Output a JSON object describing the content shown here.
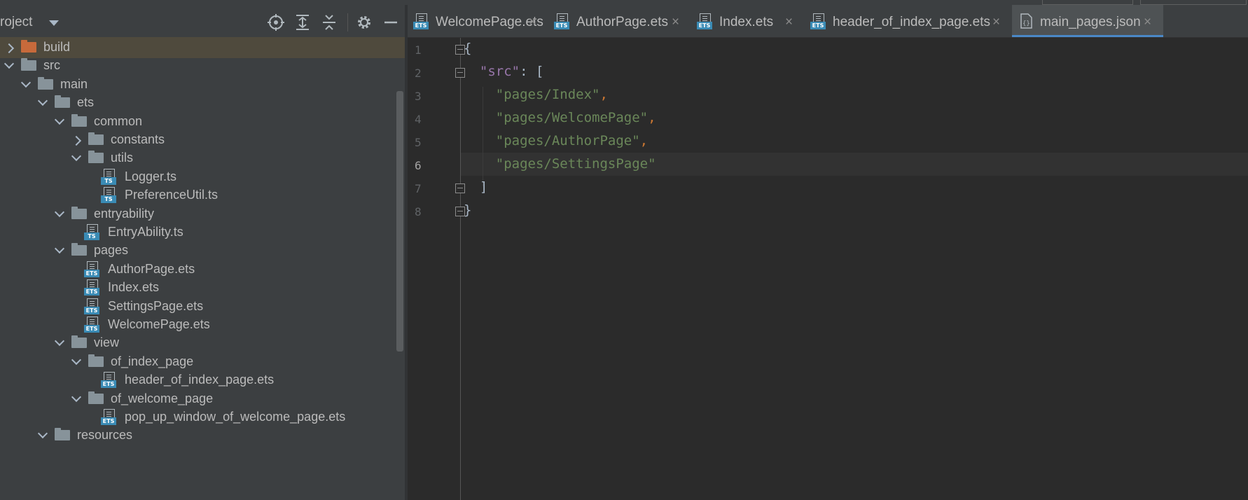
{
  "project_panel": {
    "title": "roject",
    "toolbar": [
      "target-icon",
      "expand-all-icon",
      "collapse-all-icon",
      "gear-icon",
      "minimize-icon"
    ],
    "tree": [
      {
        "label": "build",
        "type": "folder",
        "depth": 0,
        "expanded": false,
        "color": "#c76a3b",
        "selected": true
      },
      {
        "label": "src",
        "type": "folder",
        "depth": 0,
        "expanded": true
      },
      {
        "label": "main",
        "type": "folder",
        "depth": 1,
        "expanded": true
      },
      {
        "label": "ets",
        "type": "folder",
        "depth": 2,
        "expanded": true
      },
      {
        "label": "common",
        "type": "folder",
        "depth": 3,
        "expanded": true
      },
      {
        "label": "constants",
        "type": "folder",
        "depth": 4,
        "expanded": false
      },
      {
        "label": "utils",
        "type": "folder",
        "depth": 4,
        "expanded": true
      },
      {
        "label": "Logger.ts",
        "type": "file",
        "badge": "TS",
        "depth": 5
      },
      {
        "label": "PreferenceUtil.ts",
        "type": "file",
        "badge": "TS",
        "depth": 5
      },
      {
        "label": "entryability",
        "type": "folder",
        "depth": 3,
        "expanded": true
      },
      {
        "label": "EntryAbility.ts",
        "type": "file",
        "badge": "TS",
        "depth": 4
      },
      {
        "label": "pages",
        "type": "folder",
        "depth": 3,
        "expanded": true
      },
      {
        "label": "AuthorPage.ets",
        "type": "file",
        "badge": "ETS",
        "depth": 4
      },
      {
        "label": "Index.ets",
        "type": "file",
        "badge": "ETS",
        "depth": 4
      },
      {
        "label": "SettingsPage.ets",
        "type": "file",
        "badge": "ETS",
        "depth": 4
      },
      {
        "label": "WelcomePage.ets",
        "type": "file",
        "badge": "ETS",
        "depth": 4
      },
      {
        "label": "view",
        "type": "folder",
        "depth": 3,
        "expanded": true
      },
      {
        "label": "of_index_page",
        "type": "folder",
        "depth": 4,
        "expanded": true
      },
      {
        "label": "header_of_index_page.ets",
        "type": "file",
        "badge": "ETS",
        "depth": 5
      },
      {
        "label": "of_welcome_page",
        "type": "folder",
        "depth": 4,
        "expanded": true
      },
      {
        "label": "pop_up_window_of_welcome_page.ets",
        "type": "file",
        "badge": "ETS",
        "depth": 5
      },
      {
        "label": "resources",
        "type": "folder",
        "depth": 2,
        "expanded": true
      }
    ]
  },
  "tabs": [
    {
      "label": "WelcomePage.ets",
      "badge": "ETS",
      "active": false
    },
    {
      "label": "AuthorPage.ets",
      "badge": "ETS",
      "active": false
    },
    {
      "label": "Index.ets",
      "badge": "ETS",
      "active": false
    },
    {
      "label": "header_of_index_page.ets",
      "badge": "ETS",
      "active": false
    },
    {
      "label": "main_pages.json",
      "badge": "json",
      "active": true
    }
  ],
  "close_glyph": "×",
  "editor": {
    "current_line": 6,
    "lines": [
      {
        "n": "1",
        "tokens": [
          {
            "t": "{",
            "c": "plain"
          }
        ]
      },
      {
        "n": "2",
        "tokens": [
          {
            "t": "  ",
            "c": "plain"
          },
          {
            "t": "\"src\"",
            "c": "key"
          },
          {
            "t": ": [",
            "c": "plain"
          }
        ]
      },
      {
        "n": "3",
        "tokens": [
          {
            "t": "    ",
            "c": "plain"
          },
          {
            "t": "\"pages/Index\"",
            "c": "str"
          },
          {
            "t": ",",
            "c": "punct"
          }
        ]
      },
      {
        "n": "4",
        "tokens": [
          {
            "t": "    ",
            "c": "plain"
          },
          {
            "t": "\"pages/WelcomePage\"",
            "c": "str"
          },
          {
            "t": ",",
            "c": "punct"
          }
        ]
      },
      {
        "n": "5",
        "tokens": [
          {
            "t": "    ",
            "c": "plain"
          },
          {
            "t": "\"pages/AuthorPage\"",
            "c": "str"
          },
          {
            "t": ",",
            "c": "punct"
          }
        ]
      },
      {
        "n": "6",
        "tokens": [
          {
            "t": "    ",
            "c": "plain"
          },
          {
            "t": "\"pages/SettingsPage\"",
            "c": "str"
          }
        ]
      },
      {
        "n": "7",
        "tokens": [
          {
            "t": "  ]",
            "c": "plain"
          }
        ]
      },
      {
        "n": "8",
        "tokens": [
          {
            "t": "}",
            "c": "plain"
          }
        ]
      }
    ]
  },
  "colors": {
    "key": "#9876aa",
    "string": "#6a8759",
    "punct": "#cc7832",
    "active_tab_underline": "#4a88c7"
  }
}
